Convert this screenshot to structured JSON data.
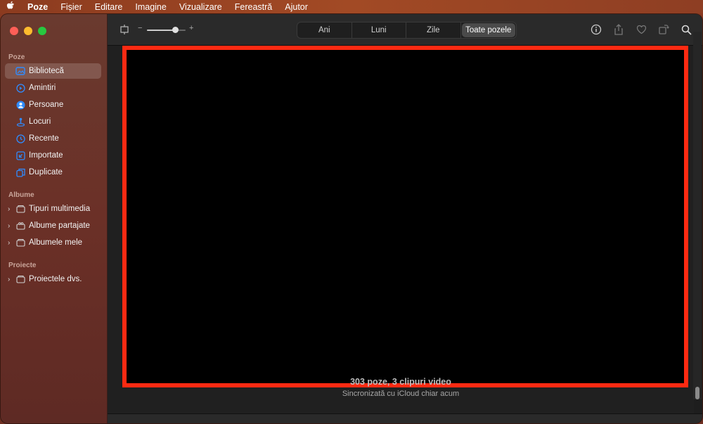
{
  "menubar": {
    "app_name": "Poze",
    "items": [
      "Fișier",
      "Editare",
      "Imagine",
      "Vizualizare",
      "Fereastră",
      "Ajutor"
    ]
  },
  "sidebar": {
    "sections": [
      {
        "label": "Poze",
        "items": [
          {
            "label": "Bibliotecă",
            "icon": "library-icon",
            "selected": true
          },
          {
            "label": "Amintiri",
            "icon": "memories-icon"
          },
          {
            "label": "Persoane",
            "icon": "people-icon"
          },
          {
            "label": "Locuri",
            "icon": "places-icon"
          },
          {
            "label": "Recente",
            "icon": "recents-icon"
          },
          {
            "label": "Importate",
            "icon": "imports-icon"
          },
          {
            "label": "Duplicate",
            "icon": "duplicates-icon"
          }
        ]
      },
      {
        "label": "Albume",
        "items": [
          {
            "label": "Tipuri multimedia",
            "icon": "folder-icon"
          },
          {
            "label": "Albume partajate",
            "icon": "shared-album-icon"
          },
          {
            "label": "Albumele mele",
            "icon": "folder-icon"
          }
        ]
      },
      {
        "label": "Proiecte",
        "items": [
          {
            "label": "Proiectele dvs.",
            "icon": "folder-icon"
          }
        ]
      }
    ]
  },
  "toolbar": {
    "zoom_minus": "−",
    "zoom_plus": "+",
    "zoom_level": 0.72,
    "tabs": [
      {
        "label": "Ani"
      },
      {
        "label": "Luni"
      },
      {
        "label": "Zile"
      },
      {
        "label": "Toate pozele",
        "active": true
      }
    ],
    "right_icons": [
      "info-icon",
      "share-icon",
      "heart-icon",
      "rotate-icon",
      "search-icon"
    ]
  },
  "content": {
    "count_text": "303 poze, 3 clipuri video",
    "sync_text": "Sincronizată cu iCloud chiar acum"
  },
  "colors": {
    "accent_blue": "#2f8cff",
    "highlight_box": "#ff2a12"
  }
}
